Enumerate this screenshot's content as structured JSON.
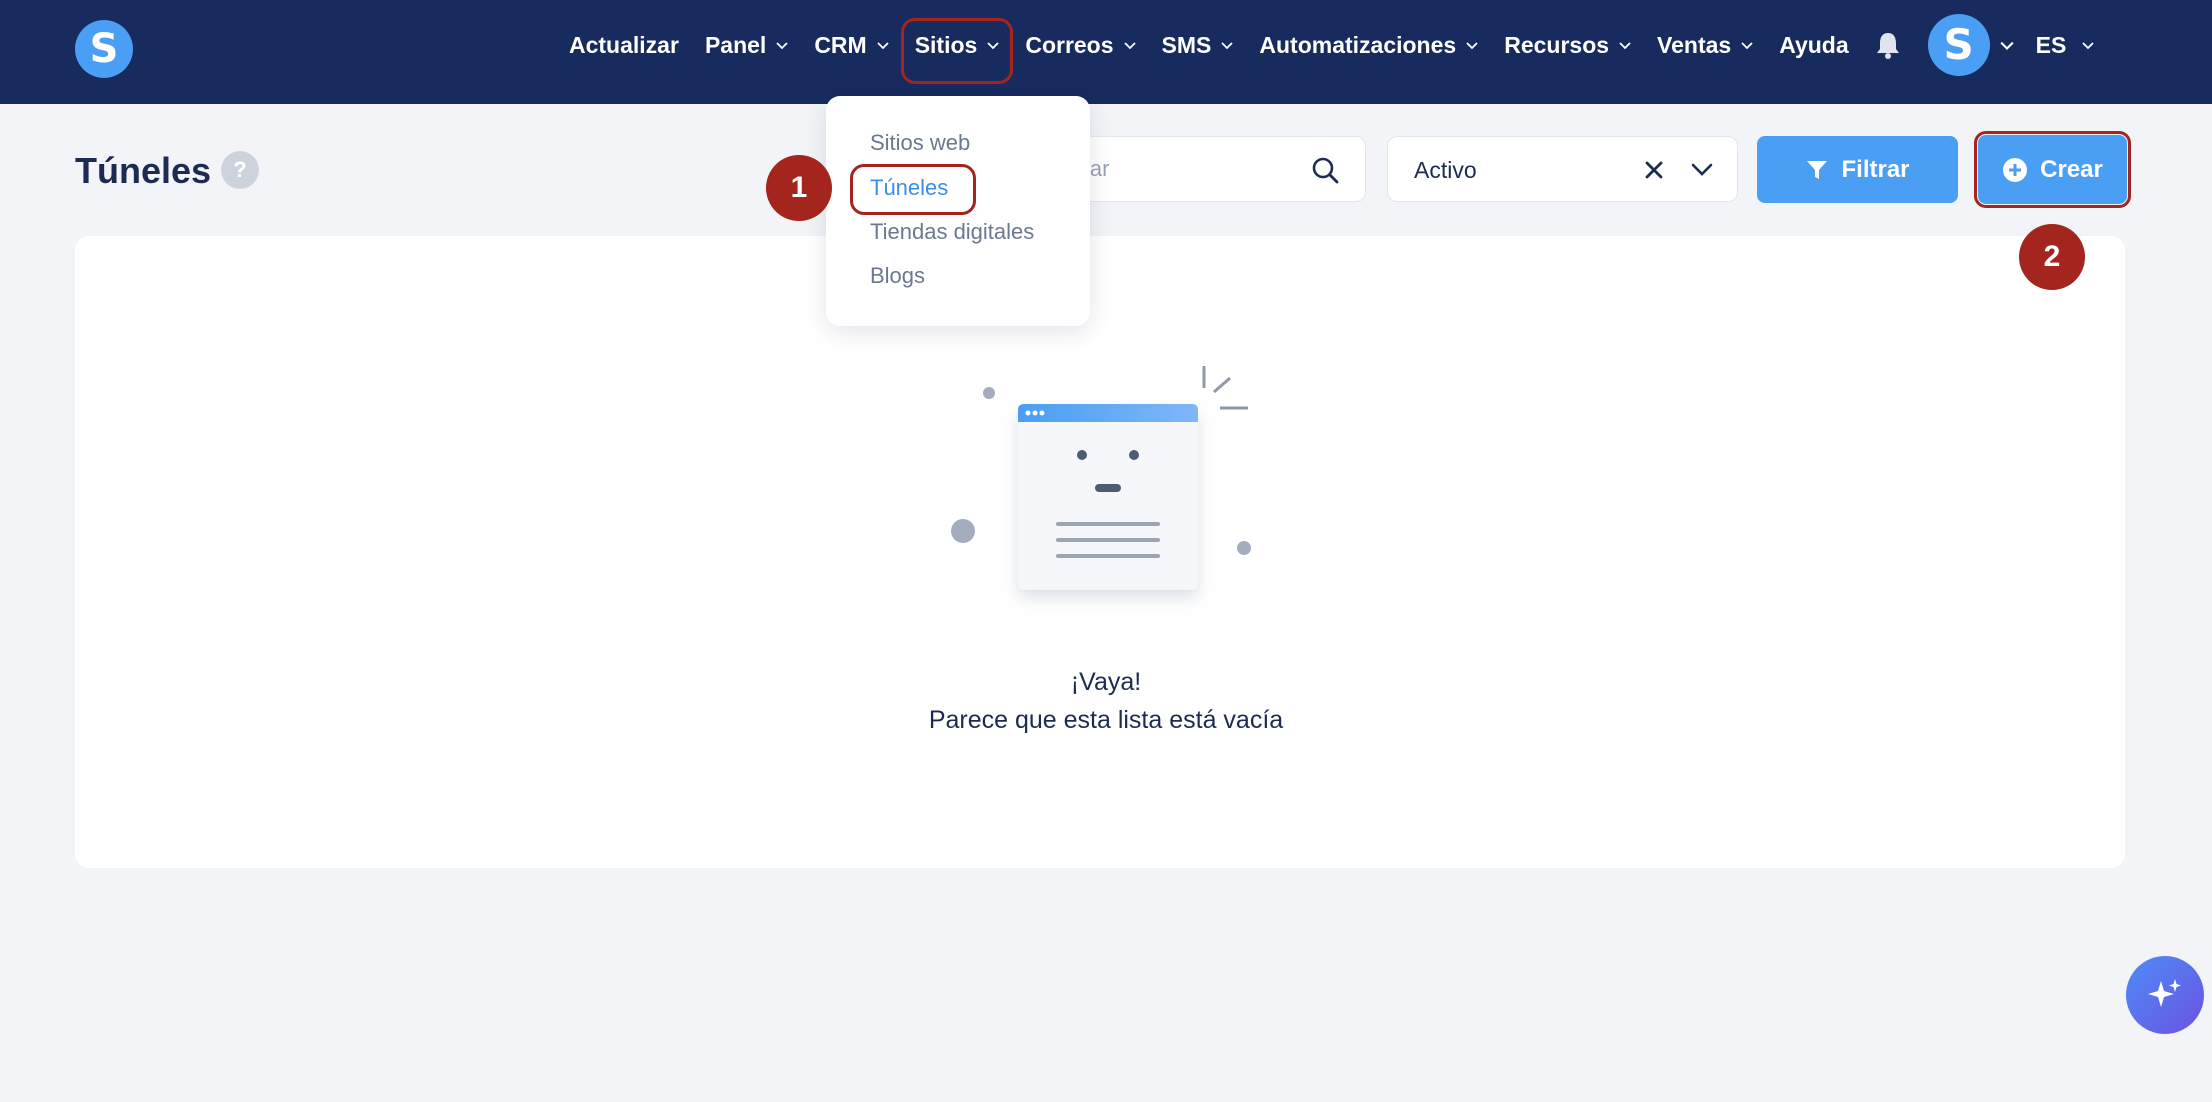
{
  "colors": {
    "nav_bg": "#172b5e",
    "accent": "#4a9ef4",
    "annotation": "#a3251e",
    "page_bg": "#f2f4f8"
  },
  "logo": {
    "letter": "S",
    "icon": "logo-icon"
  },
  "nav": {
    "items": [
      {
        "label": "Actualizar",
        "dropdown": false
      },
      {
        "label": "Panel",
        "dropdown": true
      },
      {
        "label": "CRM",
        "dropdown": true
      },
      {
        "label": "Sitios",
        "dropdown": true
      },
      {
        "label": "Correos",
        "dropdown": true
      },
      {
        "label": "SMS",
        "dropdown": true
      },
      {
        "label": "Automatizaciones",
        "dropdown": true
      },
      {
        "label": "Recursos",
        "dropdown": true
      },
      {
        "label": "Ventas",
        "dropdown": true
      },
      {
        "label": "Ayuda",
        "dropdown": false
      }
    ],
    "avatar_letter": "S",
    "language": "ES"
  },
  "dropdown": {
    "items": [
      {
        "label": "Sitios web"
      },
      {
        "label": "Túneles"
      },
      {
        "label": "Tiendas digitales"
      },
      {
        "label": "Blogs"
      }
    ],
    "active_index": 1
  },
  "page": {
    "title": "Túneles",
    "help": "?"
  },
  "toolbar": {
    "search_placeholder": "Buscar",
    "status_value": "Activo",
    "filter_label": "Filtrar",
    "create_label": "Crear"
  },
  "empty_state": {
    "title": "¡Vaya!",
    "subtitle": "Parece que esta lista está vacía"
  },
  "steps": [
    "1",
    "2"
  ]
}
